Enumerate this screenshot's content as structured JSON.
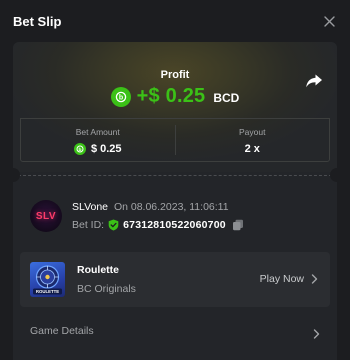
{
  "header": {
    "title": "Bet Slip"
  },
  "profit": {
    "label": "Profit",
    "amount": "+$ 0.25",
    "currency": "BCD"
  },
  "stats": {
    "bet_amount_label": "Bet Amount",
    "bet_amount_value": "$ 0.25",
    "payout_label": "Payout",
    "payout_value": "2 x"
  },
  "user": {
    "avatar_text": "SLV",
    "name": "SLVone",
    "date": "On 08.06.2023, 11:06:11",
    "bet_id_label": "Bet ID:",
    "bet_id": "67312810522060700"
  },
  "game": {
    "name": "Roulette",
    "provider": "BC Originals",
    "thumb_text": "ROULETTE",
    "play_label": "Play Now"
  },
  "details": {
    "label": "Game Details"
  },
  "colors": {
    "accent_green": "#3bc117",
    "background": "#1c1d20",
    "card": "#232529",
    "muted_text": "#a3a5a8"
  },
  "icons": {
    "close": "close-icon",
    "share": "share-icon",
    "coin": "bcd-coin-icon",
    "shield": "shield-icon",
    "copy": "copy-icon",
    "chevron": "chevron-right-icon"
  }
}
